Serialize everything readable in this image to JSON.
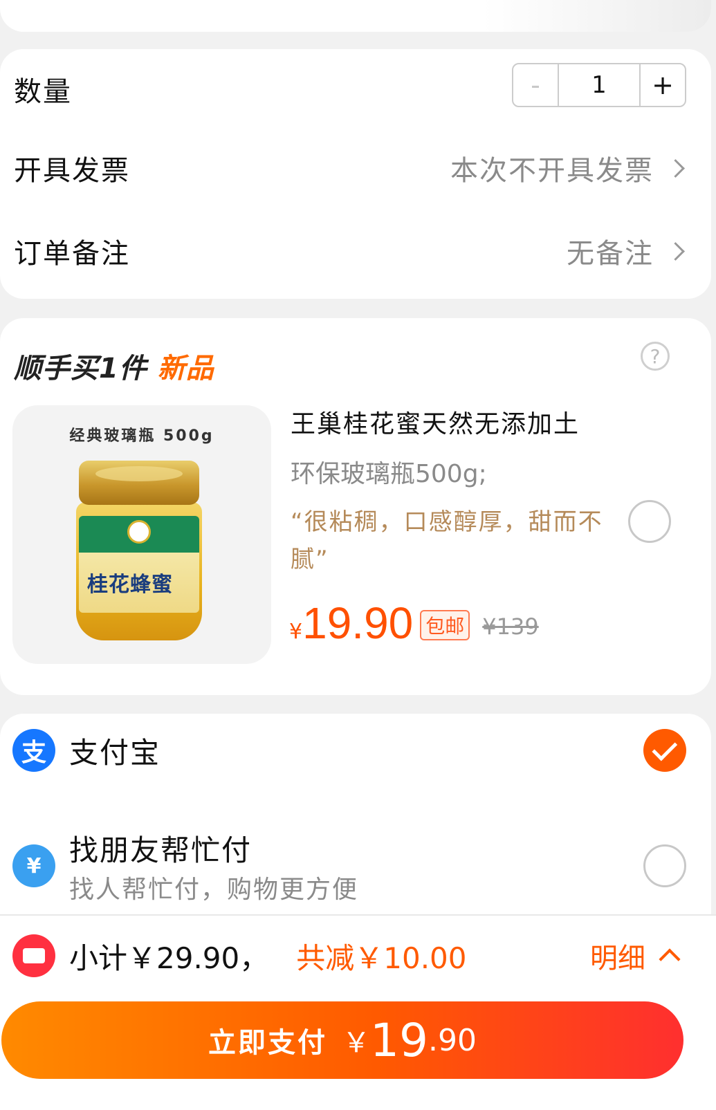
{
  "quantity": {
    "label": "数量",
    "value": "1",
    "minus": "-",
    "plus": "+"
  },
  "invoice": {
    "label": "开具发票",
    "value": "本次不开具发票"
  },
  "note": {
    "label": "订单备注",
    "value": "无备注"
  },
  "bundle": {
    "title": "顺手买1件",
    "tag": "新品",
    "help": "?",
    "product": {
      "image_caption": "经典玻璃瓶  500g",
      "image_label": "桂花蜂蜜",
      "name": "王巢桂花蜜天然无添加土",
      "spec": "环保玻璃瓶500g;",
      "quote": "“很粘稠，口感醇厚，甜而不腻”",
      "currency": "¥",
      "price": "19.90",
      "shipping_badge": "包邮",
      "original_price": "¥139"
    }
  },
  "payment": {
    "alipay": {
      "icon_glyph": "支",
      "label": "支付宝",
      "selected": true
    },
    "friend_pay": {
      "icon_glyph": "¥",
      "label": "找朋友帮忙付",
      "sub": "找人帮忙付，购物更方便",
      "selected": false
    }
  },
  "summary": {
    "subtotal": "小计￥29.90，",
    "discount": "共减￥10.00",
    "detail": "明细"
  },
  "pay_button": {
    "label": "立即支付",
    "currency": "￥",
    "amount_int": "19",
    "amount_dec": ".90"
  },
  "colors": {
    "accent": "#ff5a00",
    "price": "#ff5000",
    "quote": "#b58a59",
    "alipay": "#1677ff"
  }
}
